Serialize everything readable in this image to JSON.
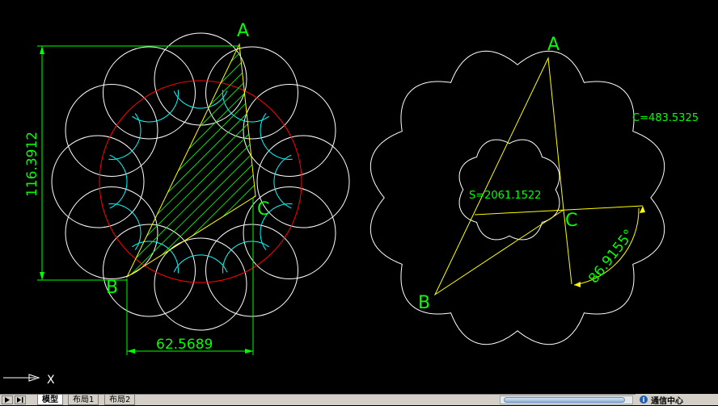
{
  "drawing": {
    "left_figure": {
      "points": {
        "a": "A",
        "b": "B",
        "c": "C"
      },
      "dim_vertical": "116.3912",
      "dim_horizontal": "62.5689"
    },
    "right_figure": {
      "points": {
        "a": "A",
        "b": "B",
        "c": "C"
      },
      "area_label": "S=2061.1522",
      "perimeter_label": "C=483.5325",
      "angle_label": "86.9155°"
    }
  },
  "ucs": {
    "axis_label": "X"
  },
  "layout_tabs": [
    {
      "label": "模型",
      "active": true
    },
    {
      "label": "布局1",
      "active": false
    },
    {
      "label": "布局2",
      "active": false
    }
  ],
  "communication_center": {
    "label": "通信中心",
    "icon": "info-icon"
  },
  "colors": {
    "background": "#000000",
    "white": "#ffffff",
    "yellow": "#ffff00",
    "green": "#00ff00",
    "red": "#ff0000",
    "cyan": "#00ffff"
  }
}
